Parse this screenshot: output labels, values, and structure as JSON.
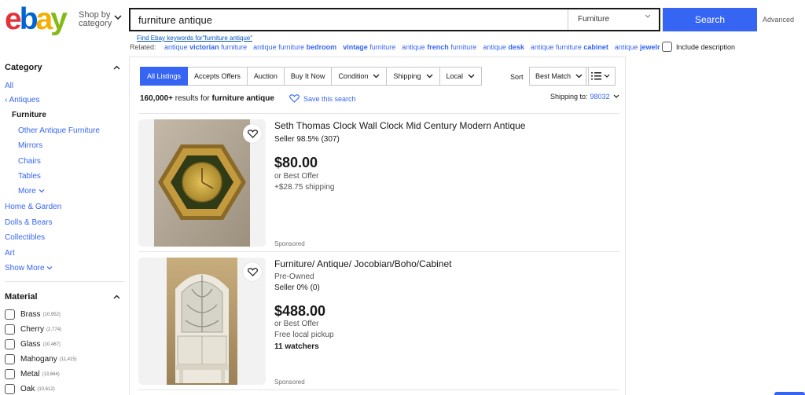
{
  "header": {
    "logo_letters": {
      "e": "e",
      "b": "b",
      "a": "a",
      "y": "y"
    },
    "shop_by_line1": "Shop by",
    "shop_by_line2": "category",
    "search_value": "furniture antique",
    "category_select": "Furniture",
    "search_button": "Search",
    "advanced": "Advanced",
    "find_keywords": "Find Ebay keywords for\"furniture antique\"",
    "related_label": "Related:",
    "related_links": [
      {
        "pre": "antique ",
        "bold": "victorian",
        "post": " furniture"
      },
      {
        "pre": "antique furniture ",
        "bold": "bedroom",
        "post": ""
      },
      {
        "pre": "",
        "bold": "vintage",
        "post": " furniture"
      },
      {
        "pre": "antique ",
        "bold": "french",
        "post": " furniture"
      },
      {
        "pre": "antique ",
        "bold": "desk",
        "post": ""
      },
      {
        "pre": "antique furniture ",
        "bold": "cabinet",
        "post": ""
      },
      {
        "pre": "antique ",
        "bold": "jewelr...",
        "post": ""
      }
    ],
    "include_description": "Include description"
  },
  "sidebar": {
    "category_heading": "Category",
    "all": "All",
    "antiques": "Antiques",
    "current": "Furniture",
    "subcats": [
      "Other Antique Furniture",
      "Mirrors",
      "Chairs",
      "Tables"
    ],
    "more": "More",
    "top_cats": [
      "Home & Garden",
      "Dolls & Bears",
      "Collectibles",
      "Art"
    ],
    "show_more": "Show More",
    "material_heading": "Material",
    "materials": [
      {
        "name": "Brass",
        "count": "(10,952)"
      },
      {
        "name": "Cherry",
        "count": "(2,774)"
      },
      {
        "name": "Glass",
        "count": "(10,467)"
      },
      {
        "name": "Mahogany",
        "count": "(11,415)"
      },
      {
        "name": "Metal",
        "count": "(13,664)"
      },
      {
        "name": "Oak",
        "count": "(10,612)"
      }
    ]
  },
  "filters": {
    "buttons": [
      "All Listings",
      "Accepts Offers",
      "Auction",
      "Buy It Now"
    ],
    "dropdowns": [
      "Condition",
      "Shipping",
      "Local"
    ],
    "sort_label": "Sort",
    "sort_value": "Best Match"
  },
  "results": {
    "count": "160,000+",
    "for_text": " results for ",
    "query": "furniture antique",
    "save_search": "Save this search",
    "ship_to_label": "Shipping to:",
    "ship_to_zip": "98032"
  },
  "items": [
    {
      "title": "Seth Thomas Clock Wall Clock Mid Century Modern Antique",
      "seller": "Seller 98.5% (307)",
      "price": "$80.00",
      "offer": "or Best Offer",
      "shipping": "+$28.75 shipping",
      "sponsored": "Sponsored"
    },
    {
      "title": "Furniture/ Antique/ Jocobian/Boho/Cabinet",
      "condition": "Pre-Owned",
      "seller": "Seller 0% (0)",
      "price": "$488.00",
      "offer": "or Best Offer",
      "shipping": "Free local pickup",
      "watchers": "11 watchers",
      "sponsored": "Sponsored"
    }
  ]
}
